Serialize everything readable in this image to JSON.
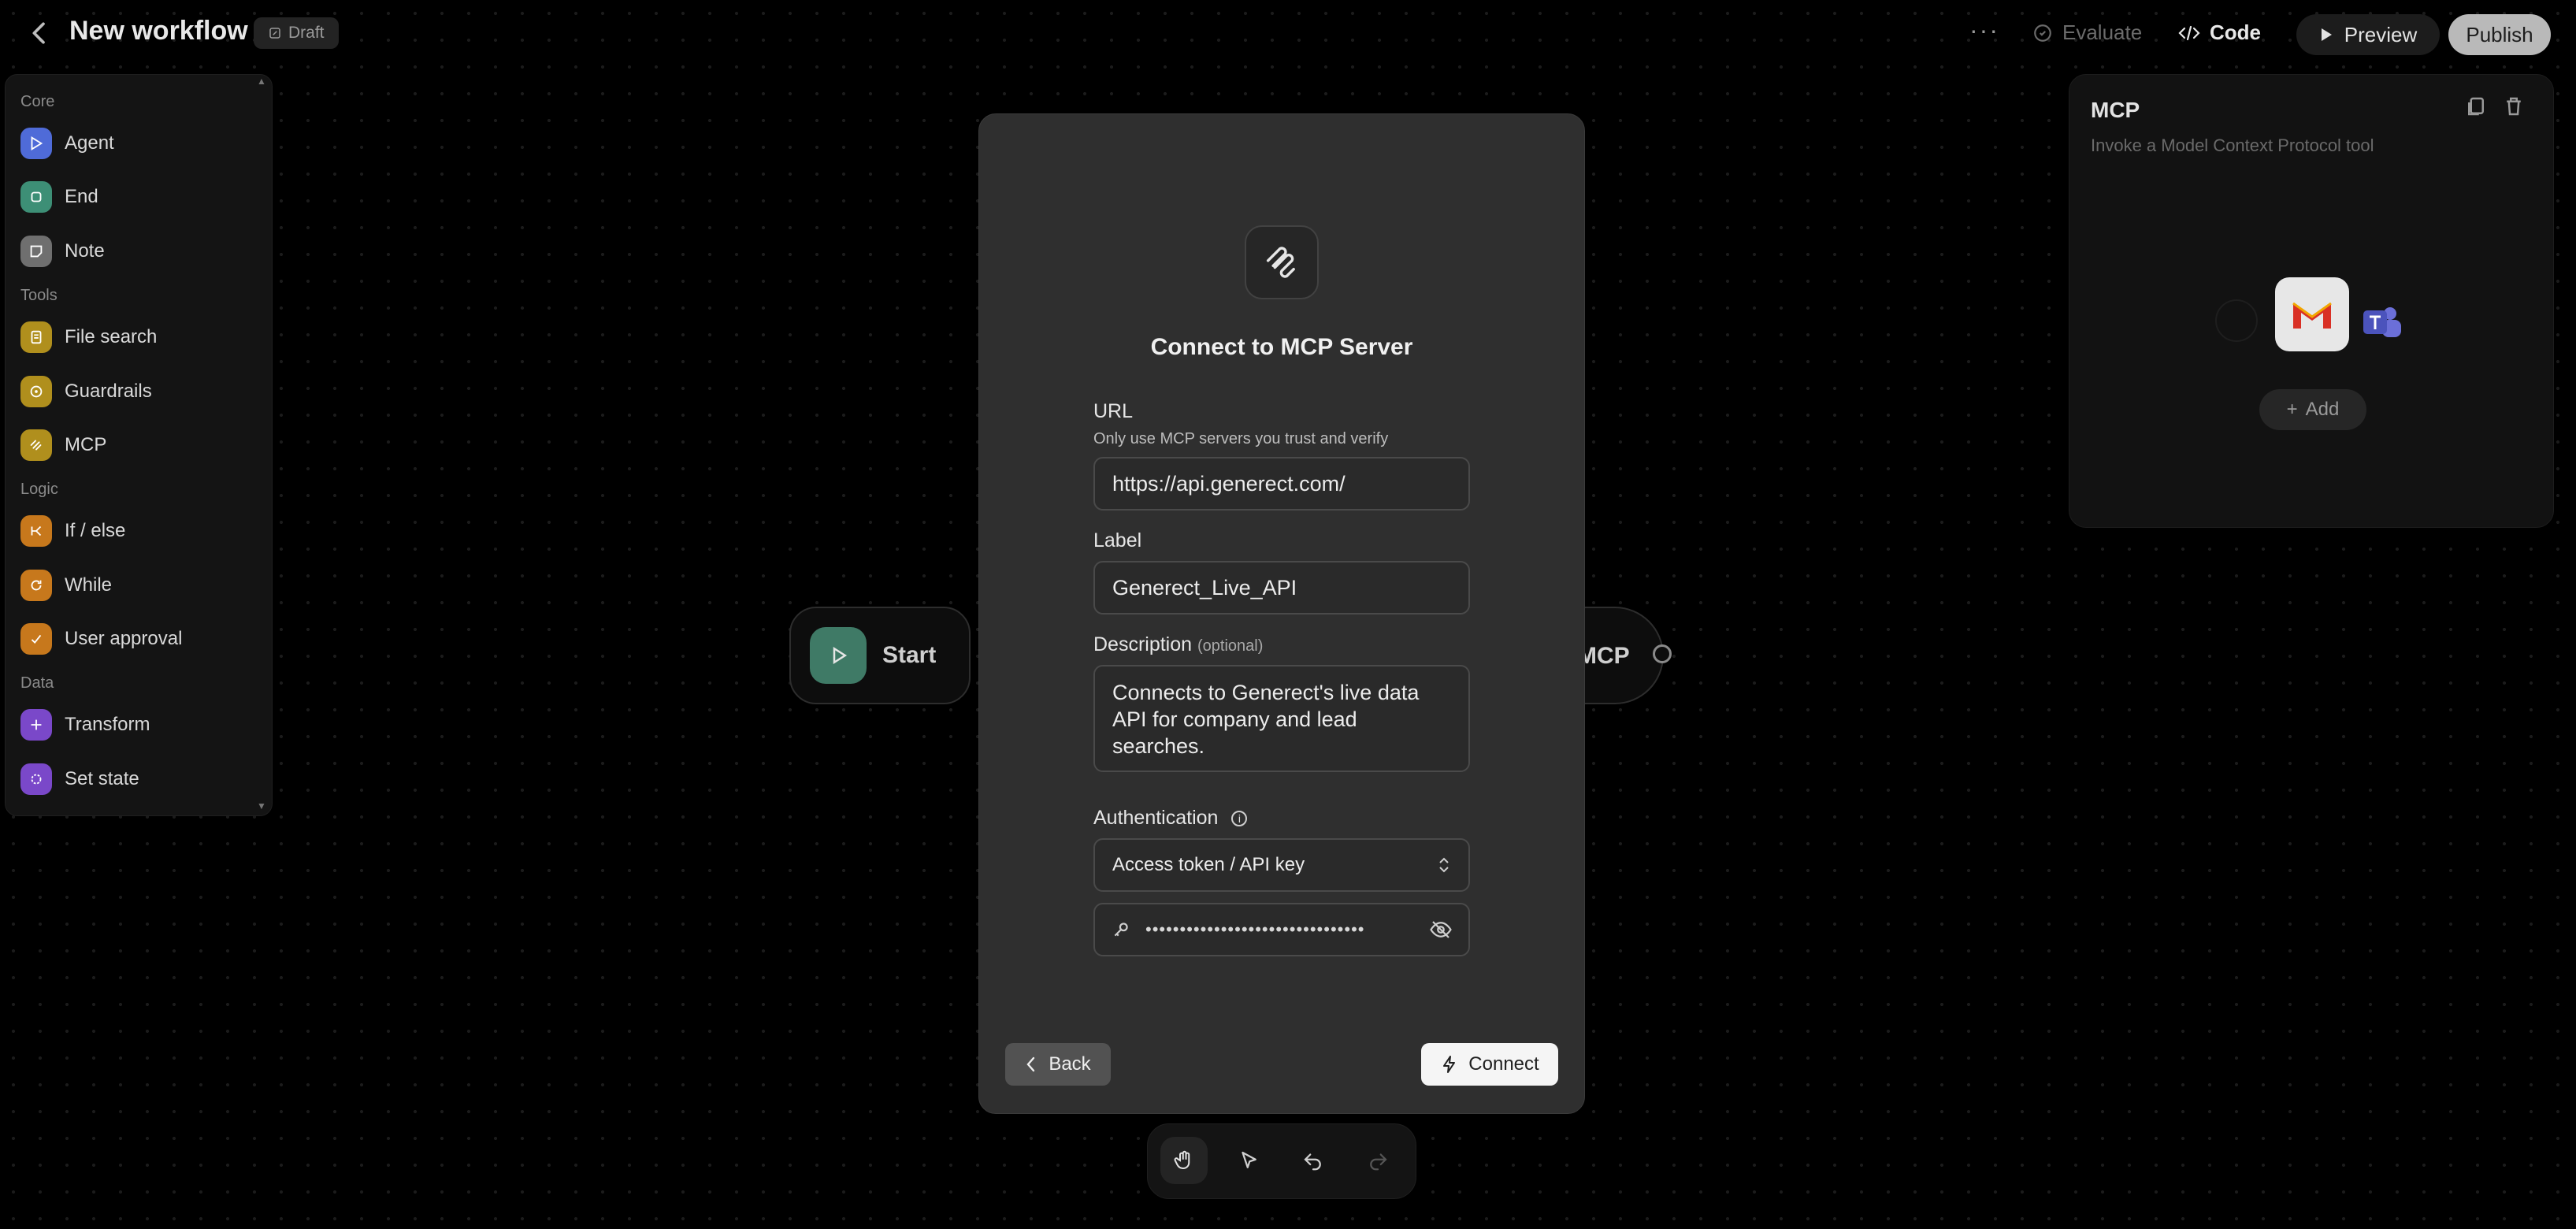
{
  "header": {
    "title": "New workflow",
    "draft_badge": "Draft",
    "more": "···",
    "evaluate": "Evaluate",
    "code": "Code",
    "preview": "Preview",
    "publish": "Publish"
  },
  "palette": {
    "sections": [
      {
        "label": "Core",
        "items": [
          {
            "label": "Agent",
            "color": "#4f6bd8"
          },
          {
            "label": "End",
            "color": "#3d8f76"
          },
          {
            "label": "Note",
            "color": "#6f6f6f"
          }
        ]
      },
      {
        "label": "Tools",
        "items": [
          {
            "label": "File search",
            "color": "#b08f1d"
          },
          {
            "label": "Guardrails",
            "color": "#b08f1d"
          },
          {
            "label": "MCP",
            "color": "#b08f1d"
          }
        ]
      },
      {
        "label": "Logic",
        "items": [
          {
            "label": "If / else",
            "color": "#c7781c"
          },
          {
            "label": "While",
            "color": "#c7781c"
          },
          {
            "label": "User approval",
            "color": "#c7781c"
          }
        ]
      },
      {
        "label": "Data",
        "items": [
          {
            "label": "Transform",
            "color": "#7a48c9"
          },
          {
            "label": "Set state",
            "color": "#7a48c9"
          }
        ]
      }
    ]
  },
  "canvas": {
    "start_node": "Start",
    "mcp_node": "MCP"
  },
  "inspector": {
    "title": "MCP",
    "subtitle": "Invoke a Model Context Protocol tool",
    "add": "Add"
  },
  "modal": {
    "title": "Connect to MCP Server",
    "url_label": "URL",
    "url_hint": "Only use MCP servers you trust and verify",
    "url_value": "https://api.generect.com/",
    "label_label": "Label",
    "label_value": "Generect_Live_API",
    "description_label": "Description",
    "description_optional": "(optional)",
    "description_value": "Connects to Generect's live data API for company and lead searches.",
    "auth_label": "Authentication",
    "auth_value": "Access token / API key",
    "token_mask": "••••••••••••••••••••••••••••••••",
    "back": "Back",
    "connect": "Connect"
  },
  "colors": {
    "accent_start": "#3f7a66",
    "gmail_red": "#d93025",
    "teams_purple": "#6b6fd8"
  }
}
